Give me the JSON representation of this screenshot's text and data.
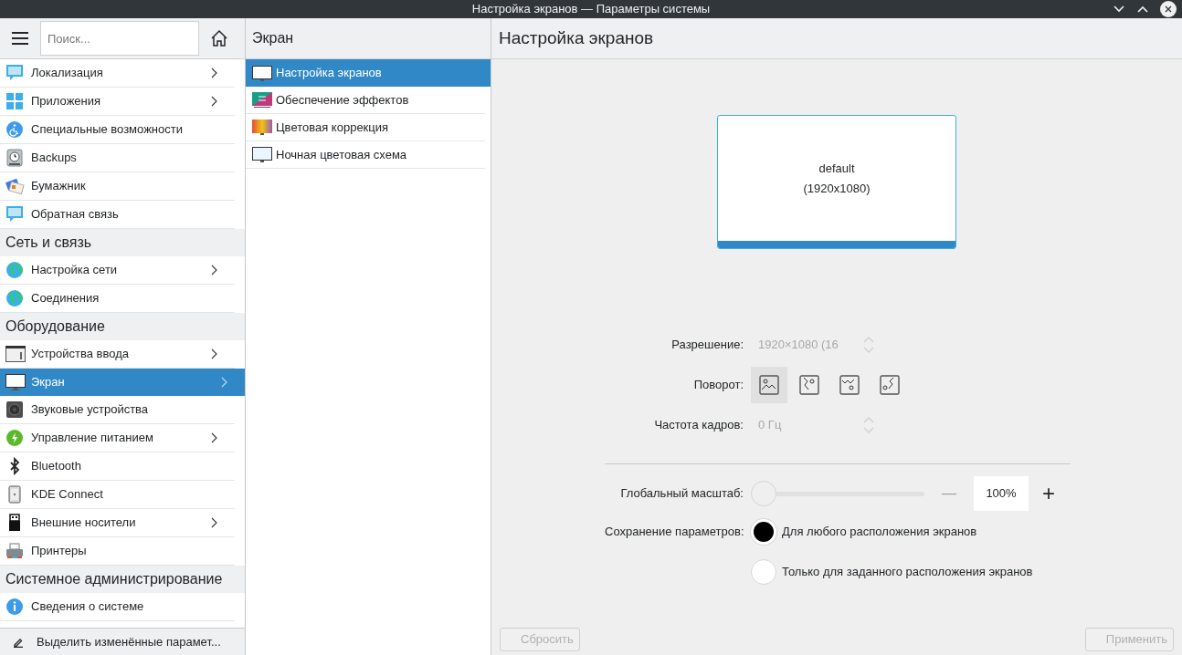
{
  "window": {
    "title": "Настройка экранов  — Параметры системы"
  },
  "sidebar": {
    "search": {
      "placeholder": "Поиск..."
    },
    "items": [
      {
        "kind": "item",
        "label": "Локализация",
        "has_arrow": true,
        "selected": false
      },
      {
        "kind": "item",
        "label": "Приложения",
        "has_arrow": true,
        "selected": false
      },
      {
        "kind": "item",
        "label": "Специальные возможности",
        "has_arrow": false,
        "selected": false
      },
      {
        "kind": "item",
        "label": "Backups",
        "has_arrow": false,
        "selected": false
      },
      {
        "kind": "item",
        "label": "Бумажник",
        "has_arrow": false,
        "selected": false
      },
      {
        "kind": "item",
        "label": "Обратная связь",
        "has_arrow": false,
        "selected": false
      },
      {
        "kind": "category",
        "label": "Сеть и связь"
      },
      {
        "kind": "item",
        "label": "Настройка сети",
        "has_arrow": true,
        "selected": false
      },
      {
        "kind": "item",
        "label": "Соединения",
        "has_arrow": false,
        "selected": false
      },
      {
        "kind": "category",
        "label": "Оборудование"
      },
      {
        "kind": "item",
        "label": "Устройства ввода",
        "has_arrow": true,
        "selected": false
      },
      {
        "kind": "item",
        "label": "Экран",
        "has_arrow": true,
        "selected": true
      },
      {
        "kind": "item",
        "label": "Звуковые устройства",
        "has_arrow": false,
        "selected": false
      },
      {
        "kind": "item",
        "label": "Управление питанием",
        "has_arrow": true,
        "selected": false
      },
      {
        "kind": "item",
        "label": "Bluetooth",
        "has_arrow": false,
        "selected": false
      },
      {
        "kind": "item",
        "label": "KDE Connect",
        "has_arrow": false,
        "selected": false
      },
      {
        "kind": "item",
        "label": "Внешние носители",
        "has_arrow": true,
        "selected": false
      },
      {
        "kind": "item",
        "label": "Принтеры",
        "has_arrow": false,
        "selected": false
      },
      {
        "kind": "category",
        "label": "Системное администрирование"
      },
      {
        "kind": "item",
        "label": "Сведения о системе",
        "has_arrow": false,
        "selected": false
      }
    ],
    "footer": "Выделить изменённые парамет..."
  },
  "subpanel": {
    "title": "Экран",
    "items": [
      {
        "label": "Настройка экранов",
        "selected": true
      },
      {
        "label": "Обеспечение эффектов",
        "selected": false
      },
      {
        "label": "Цветовая коррекция",
        "selected": false
      },
      {
        "label": "Ночная цветовая схема",
        "selected": false
      }
    ]
  },
  "page": {
    "title": "Настройка экранов",
    "output": {
      "name": "default",
      "mode": "(1920x1080)",
      "selected": true
    },
    "resolution": {
      "label": "Разрешение:",
      "value": "1920×1080 (16",
      "disabled": true
    },
    "rotation": {
      "label": "Поворот:",
      "options": [
        {
          "selected": true
        },
        {
          "selected": false
        },
        {
          "selected": false
        },
        {
          "selected": false
        }
      ]
    },
    "refresh": {
      "label": "Частота кадров:",
      "value": "0 Гц",
      "disabled": true
    },
    "scale": {
      "label": "Глобальный масштаб:",
      "level": 0,
      "value": "100%",
      "minus": "—",
      "plus": "+"
    },
    "save": {
      "label": "Сохранение параметров:",
      "options": [
        {
          "label": "Для любого расположения экранов",
          "selected": true
        },
        {
          "label": "Только для заданного расположения экранов",
          "selected": false
        }
      ]
    },
    "buttons": [
      {
        "label": "Сбросить",
        "disabled": true
      },
      {
        "label": "Применить",
        "disabled": true
      }
    ]
  }
}
